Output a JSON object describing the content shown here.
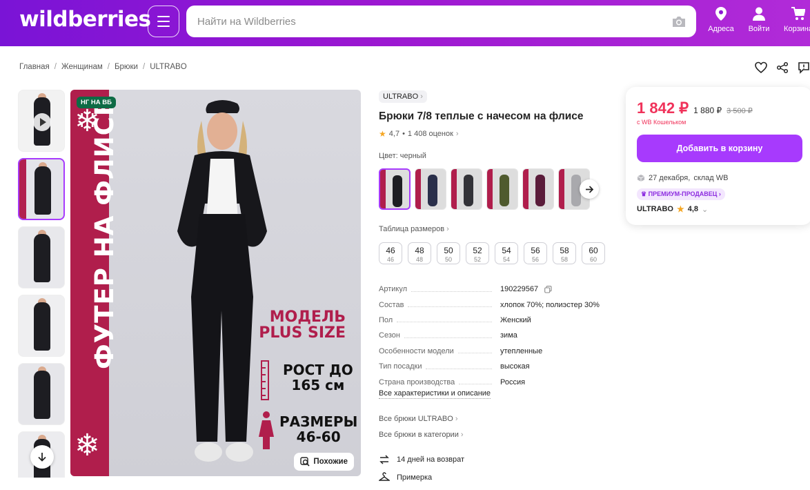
{
  "header": {
    "logo": "wildberries",
    "search_placeholder": "Найти на Wildberries",
    "nav": [
      {
        "label": "Адреса",
        "icon": "map-pin-icon"
      },
      {
        "label": "Войти",
        "icon": "user-icon"
      },
      {
        "label": "Корзина",
        "icon": "cart-icon"
      }
    ]
  },
  "breadcrumbs": [
    "Главная",
    "Женщинам",
    "Брюки",
    "ULTRABO"
  ],
  "gallery": {
    "badge": "НГ НА ВБ",
    "band_text": "ФУТЕР НА ФЛИСЕ",
    "model_line1": "МОДЕЛЬ",
    "model_line2": "PLUS SIZE",
    "growth_line1": "РОСТ ДО",
    "growth_line2": "165 см",
    "sizes_line1": "РАЗМЕРЫ",
    "sizes_line2": "46-60",
    "similar_label": "Похожие"
  },
  "product": {
    "brand": "ULTRABO",
    "title": "Брюки 7/8 теплые с начесом на флисе",
    "rating": "4,7",
    "reviews": "1 408 оценок",
    "color_label": "Цвет: черный",
    "swatch_colors": [
      "#1d1d22",
      "#2a2f4a",
      "#333338",
      "#4f5a2e",
      "#5a1c3a",
      "#a9a9ad"
    ],
    "size_table_label": "Таблица размеров",
    "sizes": [
      {
        "eu": "46",
        "ru": "46"
      },
      {
        "eu": "48",
        "ru": "48"
      },
      {
        "eu": "50",
        "ru": "50"
      },
      {
        "eu": "52",
        "ru": "52"
      },
      {
        "eu": "54",
        "ru": "54"
      },
      {
        "eu": "56",
        "ru": "56"
      },
      {
        "eu": "58",
        "ru": "58"
      },
      {
        "eu": "60",
        "ru": "60"
      }
    ],
    "specs": [
      {
        "k": "Артикул",
        "v": "190229567"
      },
      {
        "k": "Состав",
        "v": "хлопок 70%; полиэстер 30%"
      },
      {
        "k": "Пол",
        "v": "Женский"
      },
      {
        "k": "Сезон",
        "v": "зима"
      },
      {
        "k": "Особенности модели",
        "v": "утепленные"
      },
      {
        "k": "Тип посадки",
        "v": "высокая"
      },
      {
        "k": "Страна производства",
        "v": "Россия"
      }
    ],
    "all_specs_link": "Все характеристики и описание",
    "all_brand_link": "Все брюки ULTRABO",
    "all_category_link": "Все брюки в категории",
    "features": [
      "14 дней на возврат",
      "Примерка"
    ]
  },
  "buybox": {
    "price": "1 842 ₽",
    "price_no_wallet": "1 880 ₽",
    "old_price": "3 500 ₽",
    "wallet_note": "с WB Кошельком",
    "add_button": "Добавить в корзину",
    "delivery_date": "27 декабря,",
    "delivery_place": "склад WB",
    "premium_badge": "ПРЕМИУМ-ПРОДАВЕЦ",
    "seller": "ULTRABO",
    "seller_rating": "4,8"
  },
  "colors": {
    "accent": "#a73afd",
    "price": "#f0325a",
    "band": "#b01e4c",
    "badge": "#0e6b45"
  }
}
